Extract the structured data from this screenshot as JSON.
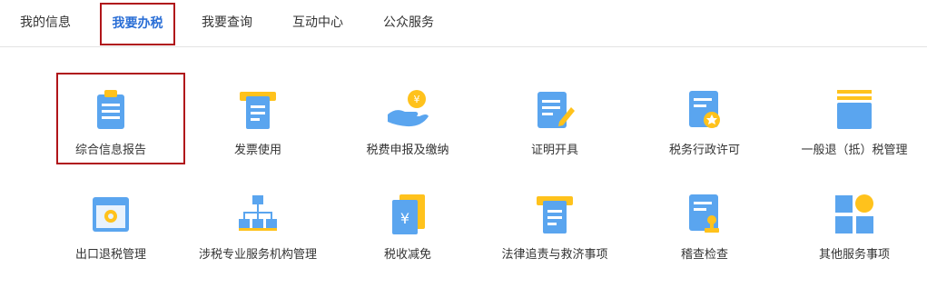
{
  "tabs": [
    {
      "label": "我的信息"
    },
    {
      "label": "我要办税",
      "active": true
    },
    {
      "label": "我要查询"
    },
    {
      "label": "互动中心"
    },
    {
      "label": "公众服务"
    }
  ],
  "items": [
    {
      "label": "综合信息报告",
      "icon": "clipboard-icon",
      "selected": true
    },
    {
      "label": "发票使用",
      "icon": "invoice-icon"
    },
    {
      "label": "税费申报及缴纳",
      "icon": "hand-coin-icon"
    },
    {
      "label": "证明开具",
      "icon": "document-pen-icon"
    },
    {
      "label": "税务行政许可",
      "icon": "certificate-star-icon"
    },
    {
      "label": "一般退（抵）税管理",
      "icon": "folder-stack-icon"
    },
    {
      "label": "出口退税管理",
      "icon": "browser-gear-icon"
    },
    {
      "label": "涉税专业服务机构管理",
      "icon": "org-chart-icon"
    },
    {
      "label": "税收减免",
      "icon": "yuan-document-icon"
    },
    {
      "label": "法律追责与救济事项",
      "icon": "legal-document-icon"
    },
    {
      "label": "稽查检查",
      "icon": "document-stamp-icon"
    },
    {
      "label": "其他服务事项",
      "icon": "app-grid-icon"
    }
  ],
  "colors": {
    "accent": "#2b6fd6",
    "highlight": "#b0151a",
    "icon_blue": "#5aa5ef",
    "icon_yellow": "#ffc21c"
  }
}
